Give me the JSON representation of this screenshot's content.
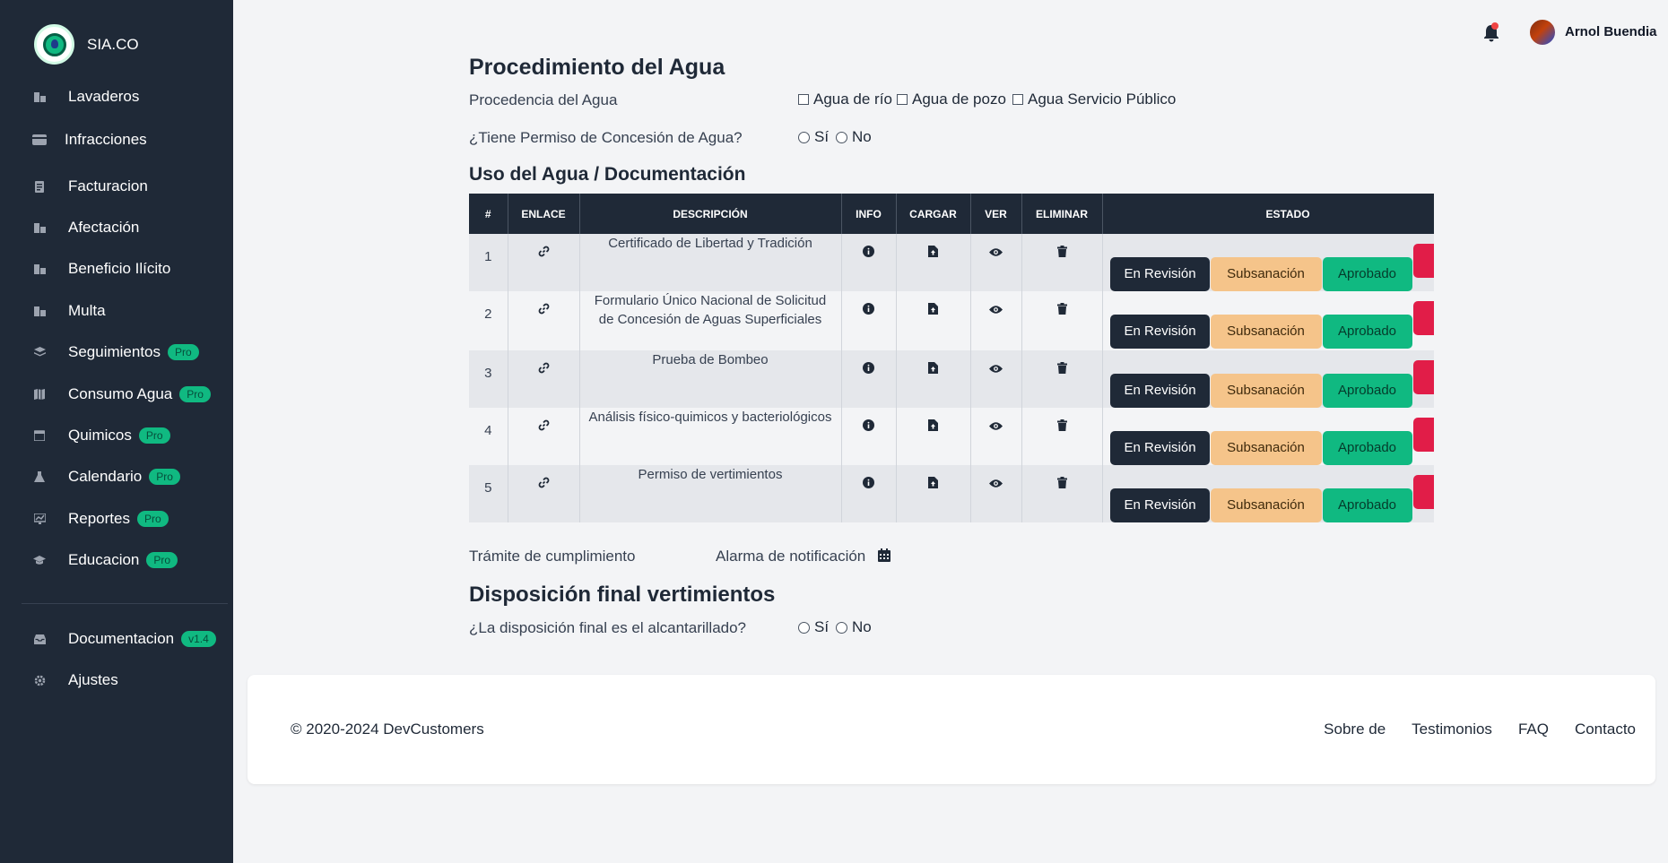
{
  "sidebar": {
    "brand": "SIA.CO",
    "items": [
      {
        "label": "Lavaderos",
        "icon": "building-icon",
        "badge": ""
      },
      {
        "label": "Infracciones",
        "icon": "credit-card-icon",
        "badge": ""
      },
      {
        "label": "Facturacion",
        "icon": "receipt-icon",
        "badge": ""
      },
      {
        "label": "Afectación",
        "icon": "building-icon",
        "badge": ""
      },
      {
        "label": "Beneficio Ilícito",
        "icon": "building-icon",
        "badge": ""
      },
      {
        "label": "Multa",
        "icon": "building-icon",
        "badge": ""
      },
      {
        "label": "Seguimientos",
        "icon": "layers-icon",
        "badge": "Pro"
      },
      {
        "label": "Consumo Agua",
        "icon": "map-icon",
        "badge": "Pro"
      },
      {
        "label": "Quimicos",
        "icon": "calendar-icon",
        "badge": "Pro"
      },
      {
        "label": "Calendario",
        "icon": "flask-icon",
        "badge": "Pro"
      },
      {
        "label": "Reportes",
        "icon": "chart-icon",
        "badge": "Pro"
      },
      {
        "label": "Educacion",
        "icon": "graduation-cap-icon",
        "badge": "Pro"
      },
      {
        "label": "Documentacion",
        "icon": "inbox-icon",
        "badge": "v1.4"
      },
      {
        "label": "Ajustes",
        "icon": "gear-icon",
        "badge": ""
      }
    ]
  },
  "header": {
    "user_name": "Arnol Buendia"
  },
  "main": {
    "title": "Procedimiento del Agua",
    "procedencia_label": "Procedencia del Agua",
    "procedencia_options": [
      "Agua de río",
      "Agua de pozo",
      "Agua Servicio Público"
    ],
    "permiso_label": "¿Tiene Permiso de Concesión de Agua?",
    "yes": "Sí",
    "no": "No",
    "uso_title": "Uso del Agua / Documentación",
    "table": {
      "headers": [
        "#",
        "ENLACE",
        "DESCRIPCIÓN",
        "INFO",
        "CARGAR",
        "VER",
        "ELIMINAR",
        "ESTADO"
      ],
      "rows": [
        {
          "num": "1",
          "desc": "Certificado de Libertad y Tradición"
        },
        {
          "num": "2",
          "desc": "Formulario Único Nacional de Solicitud de Concesión de Aguas Superficiales"
        },
        {
          "num": "3",
          "desc": "Prueba de Bombeo"
        },
        {
          "num": "4",
          "desc": "Análisis físico-quimicos y bacteriológicos"
        },
        {
          "num": "5",
          "desc": "Permiso de vertimientos"
        }
      ],
      "status_buttons": [
        "En Revisión",
        "Subsanación",
        "Aprobado"
      ]
    },
    "tramite_label": "Trámite de cumplimiento",
    "alarma_label": "Alarma de notificación",
    "disposicion_title": "Disposición final vertimientos",
    "disposicion_label": "¿La disposición final es el alcantarillado?"
  },
  "footer": {
    "copyright": "© 2020-2024 DevCustomers",
    "links": [
      "Sobre de",
      "Testimonios",
      "FAQ",
      "Contacto"
    ]
  },
  "colors": {
    "sidebar_bg": "#1f2937",
    "accent_green": "#10b981",
    "warning": "#f5c48a",
    "danger": "#e11d48"
  }
}
